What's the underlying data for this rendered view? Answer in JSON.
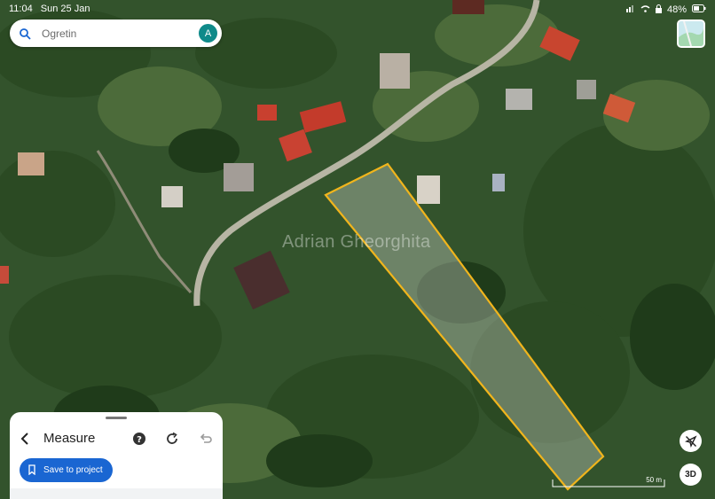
{
  "status": {
    "time": "11:04",
    "date": "Sun 25 Jan",
    "battery": "48%"
  },
  "search": {
    "placeholder": "Ogretin",
    "avatar_letter": "A"
  },
  "watermark": "Adrian Gheorghita",
  "panel": {
    "title": "Measure",
    "save_label": "Save to project"
  },
  "map_controls": {
    "three_d_label": "3D"
  },
  "scale": {
    "label": "50 m"
  },
  "colors": {
    "accent": "#1a66d2",
    "outline": "#f1b51c",
    "avatar": "#0f8a8a"
  },
  "icons": [
    "search-icon",
    "avatar",
    "layers-icon",
    "back-arrow-icon",
    "help-icon",
    "redo-icon",
    "undo-icon",
    "bookmark-icon",
    "location-off-icon"
  ]
}
